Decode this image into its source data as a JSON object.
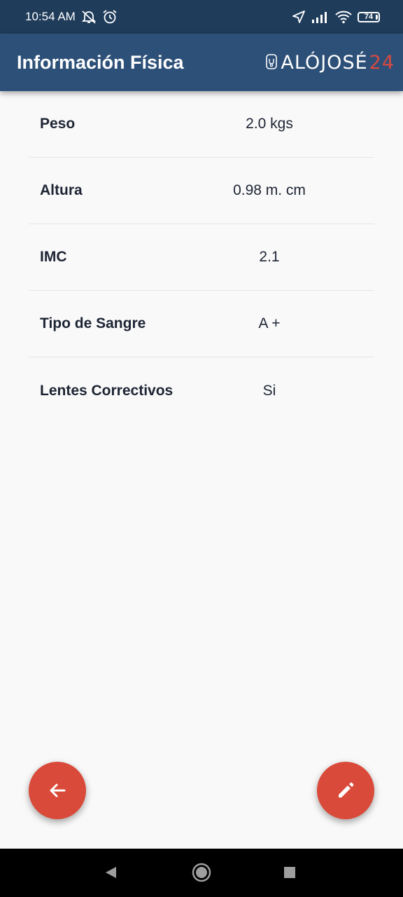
{
  "status_bar": {
    "time": "10:54 AM",
    "icons_left": [
      "mute-icon",
      "alarm-icon"
    ],
    "icons_right": [
      "location-icon",
      "signal-icon",
      "wifi-icon",
      "battery-icon"
    ],
    "battery_level": "74"
  },
  "app_bar": {
    "title": "Información Física",
    "logo_main": "ALÓJOSÉ",
    "logo_num": "24"
  },
  "rows": [
    {
      "label": "Peso",
      "value": "2.0 kgs"
    },
    {
      "label": "Altura",
      "value": "0.98 m. cm"
    },
    {
      "label": "IMC",
      "value": "2.1"
    },
    {
      "label": "Tipo de Sangre",
      "value": "A +"
    },
    {
      "label": "Lentes Correctivos",
      "value": "Si"
    }
  ],
  "fabs": {
    "back_icon": "arrow-left-icon",
    "edit_icon": "pencil-icon"
  },
  "colors": {
    "status_bar": "#1f3c5b",
    "app_bar": "#2d5078",
    "accent": "#d94a3a",
    "background": "#f9f9f9"
  }
}
